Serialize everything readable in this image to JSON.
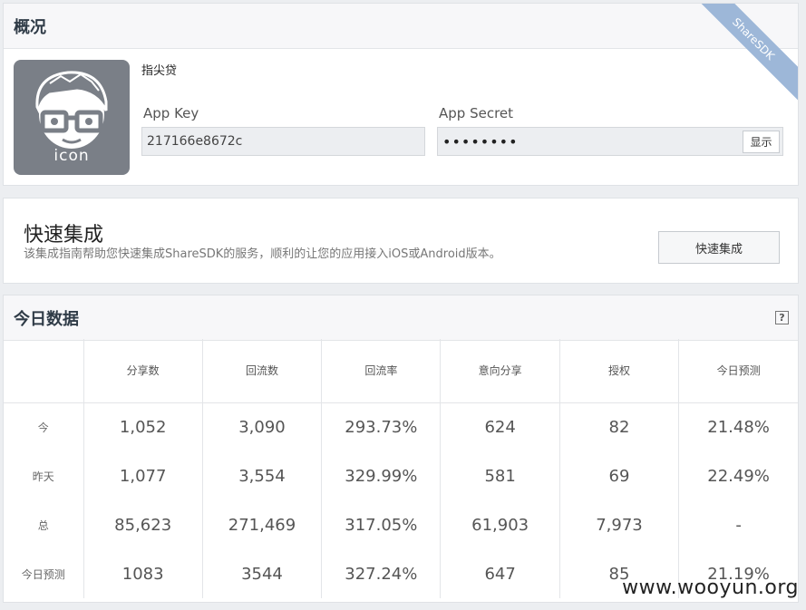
{
  "overview": {
    "title": "概况",
    "ribbon": "ShareSDK",
    "icon_label": "icon",
    "app_name": "指尖贷",
    "app_key_label": "App Key",
    "app_key_value": "217166e8672c",
    "app_secret_label": "App Secret",
    "app_secret_value": "••••••••",
    "show_button": "显示"
  },
  "quick": {
    "title": "快速集成",
    "description": "该集成指南帮助您快速集成ShareSDK的服务，顺利的让您的应用接入iOS或Android版本。",
    "button": "快速集成"
  },
  "today": {
    "title": "今日数据",
    "help": "?",
    "columns": [
      "",
      "分享数",
      "回流数",
      "回流率",
      "意向分享",
      "授权",
      "今日预测"
    ],
    "rows": [
      {
        "label": "今",
        "values": [
          "1,052",
          "3,090",
          "293.73%",
          "624",
          "82",
          "21.48%"
        ]
      },
      {
        "label": "昨天",
        "values": [
          "1,077",
          "3,554",
          "329.99%",
          "581",
          "69",
          "22.49%"
        ]
      },
      {
        "label": "总",
        "values": [
          "85,623",
          "271,469",
          "317.05%",
          "61,903",
          "7,973",
          "-"
        ]
      },
      {
        "label": "今日预测",
        "values": [
          "1083",
          "3544",
          "327.24%",
          "647",
          "85",
          "21.19%"
        ]
      }
    ]
  },
  "watermark": "www.wooyun.org",
  "colors": {
    "ribbon": "#9db7d8",
    "icon_bg": "#7a7f87",
    "header_bg": "#f7f7f9"
  }
}
